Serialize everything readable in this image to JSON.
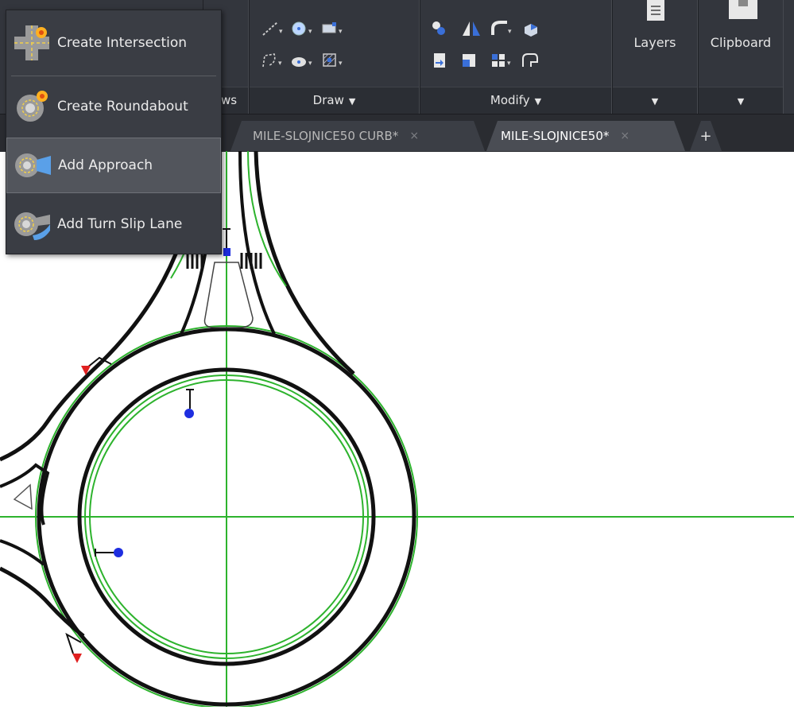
{
  "menu": {
    "items": [
      {
        "label": "Create Intersection",
        "icon": "intersection-icon"
      },
      {
        "label": "Create Roundabout",
        "icon": "roundabout-icon"
      },
      {
        "label": "Add Approach",
        "icon": "approach-icon",
        "highlighted": true
      },
      {
        "label": "Add Turn Slip Lane",
        "icon": "slip-lane-icon"
      }
    ]
  },
  "ribbon": {
    "partial_label": "ws",
    "draw_label": "Draw",
    "modify_label": "Modify",
    "layers_label": "Layers",
    "clipboard_label": "Clipboard"
  },
  "tabs": [
    {
      "label": "MILE-SLOJNICE50 CURB*",
      "active": false
    },
    {
      "label": "MILE-SLOJNICE50*",
      "active": true
    }
  ],
  "tab_close": "×",
  "tab_add": "+",
  "colors": {
    "ribbon_bg": "#33363d",
    "guide_green": "#2db32d",
    "curb_black": "#111111",
    "marker_blue": "#1e2ee0",
    "marker_red": "#e02020"
  }
}
